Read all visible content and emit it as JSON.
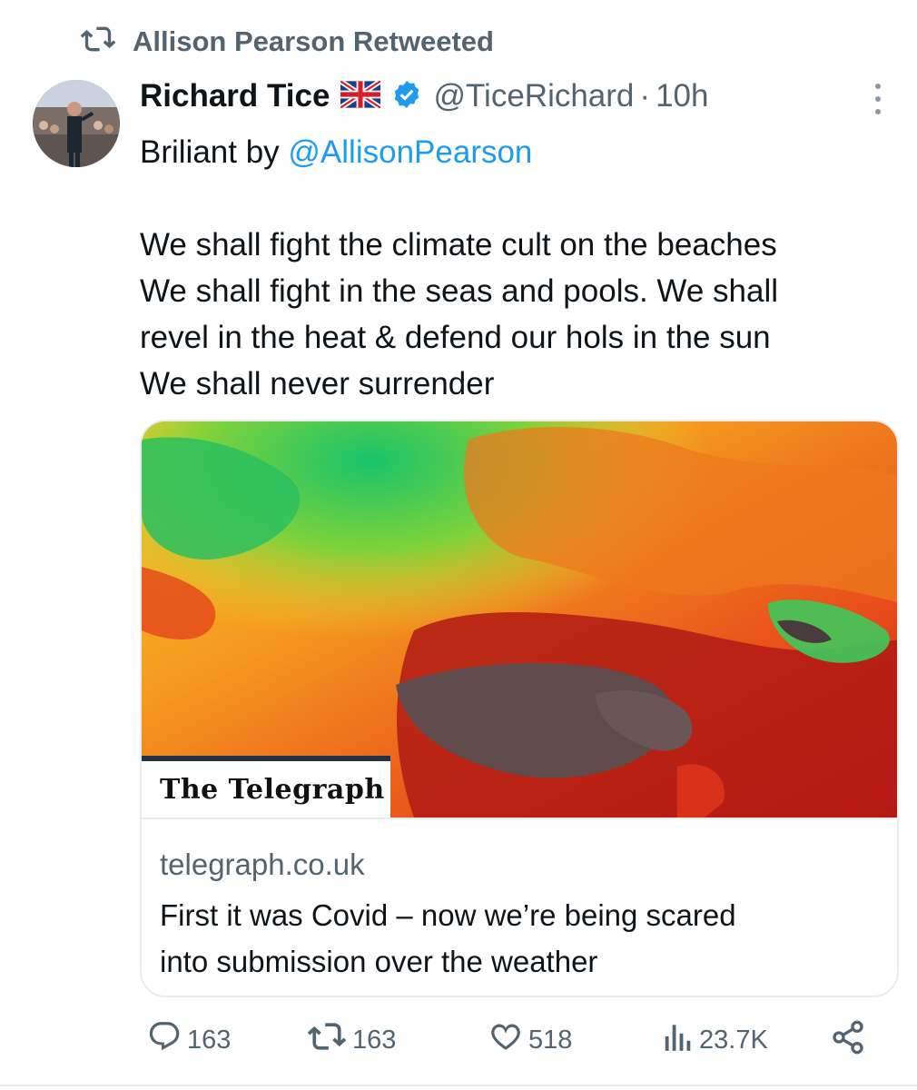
{
  "retweet": {
    "label": "Allison Pearson Retweeted"
  },
  "author": {
    "name": "Richard Tice",
    "handle": "@TiceRichard",
    "separator": "·",
    "time": "10h"
  },
  "tweet": {
    "intro_prefix": "Briliant by ",
    "intro_mention": "@AllisonPearson",
    "lines": [
      "We shall fight the climate cult on the beaches",
      "We shall fight in the seas and pools. We shall",
      "revel in the heat & defend our hols in the sun",
      "We shall never surrender"
    ]
  },
  "card": {
    "brand": "The Telegraph",
    "domain": "telegraph.co.uk",
    "title_lines": [
      "First it was Covid – now we’re being scared",
      "into submission over the weather"
    ]
  },
  "actions": {
    "replies": "163",
    "retweets": "163",
    "likes": "518",
    "views": "23.7K"
  },
  "icons": [
    "retweet-icon",
    "flag-icon",
    "verified-icon",
    "more-icon",
    "reply-icon",
    "like-icon",
    "views-icon",
    "share-icon"
  ],
  "colors": {
    "accent": "#1d9bf0",
    "muted": "#536471",
    "text": "#0f1419"
  }
}
